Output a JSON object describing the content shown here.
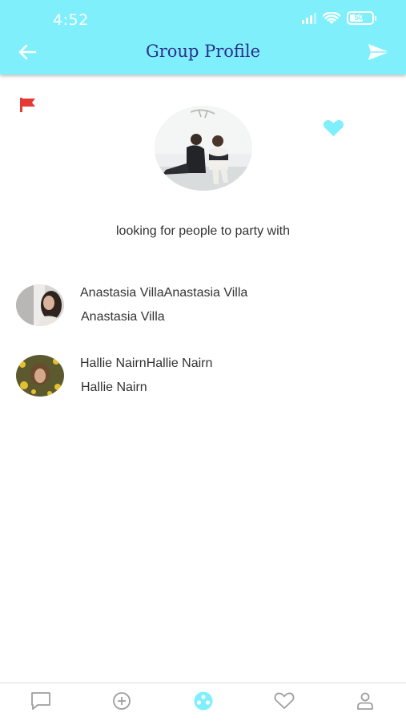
{
  "status_bar": {
    "time": "4:52",
    "battery": "50",
    "icons": [
      "signal-icon",
      "wifi-icon",
      "battery-icon"
    ]
  },
  "header": {
    "title": "Group Profile",
    "background": "#7ff0fb",
    "title_color": "#2b2f8f",
    "left_icon": "back-arrow-icon",
    "right_icon": "send-icon"
  },
  "group": {
    "description": "looking for people to party with",
    "flag_icon": "flag-icon",
    "flag_color": "#e53935",
    "favorite_icon": "heart-icon",
    "favorite_color": "#7ff0fb"
  },
  "members": [
    {
      "line1": "Anastasia VillaAnastasia Villa",
      "line2": "Anastasia Villa"
    },
    {
      "line1": "Hallie NairnHallie Nairn",
      "line2": "Hallie Nairn"
    }
  ],
  "tabbar": {
    "tabs": [
      {
        "icon": "chat-icon",
        "active": false
      },
      {
        "icon": "add-circle-icon",
        "active": false
      },
      {
        "icon": "groups-icon",
        "active": true
      },
      {
        "icon": "heart-icon",
        "active": false
      },
      {
        "icon": "profile-icon",
        "active": false
      }
    ],
    "active_color": "#7ff0fb",
    "inactive_color": "#9e9e9e"
  }
}
